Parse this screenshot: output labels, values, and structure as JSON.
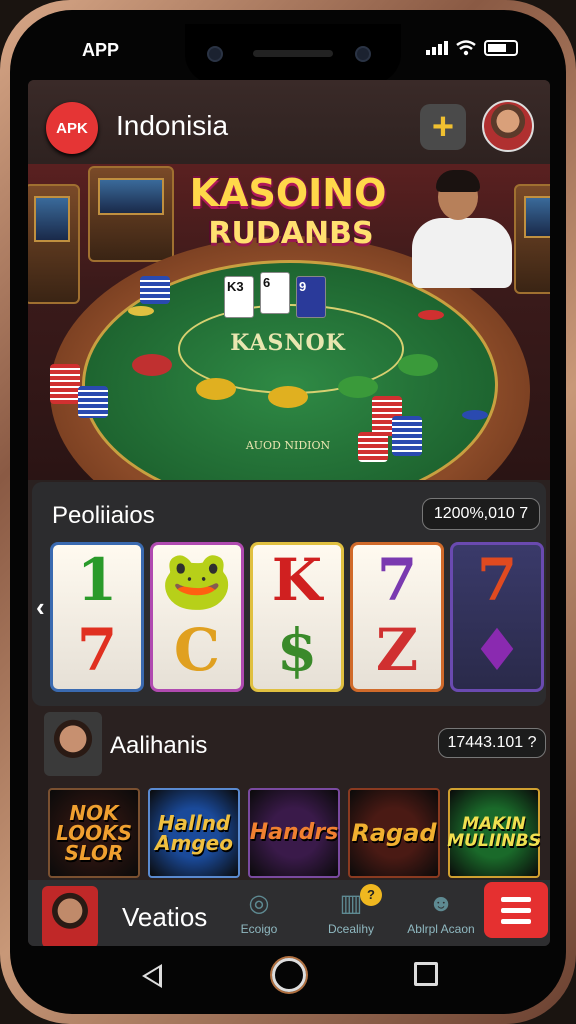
{
  "status_bar": {
    "app_label": "APP"
  },
  "header": {
    "badge": "APK",
    "title": "Indonisia",
    "add_button": "+"
  },
  "hero": {
    "title_line1": "KASOINO",
    "title_line2": "RUDANBS",
    "table_label": "KASNOK",
    "table_bottom_text": "AUOD NIDION",
    "cards": [
      "K3",
      "6",
      "9"
    ]
  },
  "slots_panel": {
    "title": "Peoliiaios",
    "amount": "1200%,010 7",
    "reels": [
      {
        "top": "1",
        "bottom": "7",
        "top_color": "#2a9a2a",
        "bottom_color": "#e03020",
        "border": "#3a6ab0"
      },
      {
        "top": "🐸",
        "bottom": "C",
        "top_color": "#2a9a2a",
        "bottom_color": "#e0a020",
        "border": "#b04ab0"
      },
      {
        "top": "K",
        "bottom": "$",
        "top_color": "#d02020",
        "bottom_color": "#3a8a2a",
        "border": "#e0c040"
      },
      {
        "top": "7",
        "bottom": "Z",
        "top_color": "#7a3ab0",
        "bottom_color": "#d03030",
        "border": "#d06a2a"
      },
      {
        "top": "7",
        "bottom": "♦",
        "top_color": "#e04a20",
        "bottom_color": "#8a2ab0",
        "border": "#6a4ab0"
      }
    ],
    "prev_arrow": "‹",
    "next_arrow": "›"
  },
  "players": {
    "title": "Aalihanis",
    "amount": "17443.101 ?"
  },
  "games": [
    {
      "label": "NOK LOOKS SLOR",
      "bg": "#2a1410",
      "color": "#f0a030",
      "border": "#7a5030"
    },
    {
      "label": "Hallnd Amgeo",
      "bg": "#1a4a9a",
      "color": "#f0c040",
      "border": "#5a8ad0"
    },
    {
      "label": "Handrs",
      "bg": "#3a1a4a",
      "color": "#f08030",
      "border": "#7a4aa0"
    },
    {
      "label": "Ragad",
      "bg": "#4a1a14",
      "color": "#f0b030",
      "border": "#8a3a20"
    },
    {
      "label": "MAKIN MULIINBS",
      "bg": "#1a6a2a",
      "color": "#f0e050",
      "border": "#d0a030"
    }
  ],
  "bottom_nav": {
    "user_name": "Veatios",
    "items": [
      {
        "label": "Ecoigo",
        "icon": "target-icon"
      },
      {
        "label": "Dcealihy",
        "icon": "building-icon",
        "badge": "?"
      },
      {
        "label": "Ablrpl Acaon",
        "icon": "people-icon"
      }
    ]
  },
  "colors": {
    "accent_red": "#e53030",
    "gold": "#f0c030",
    "panel": "#2c2c2e"
  }
}
